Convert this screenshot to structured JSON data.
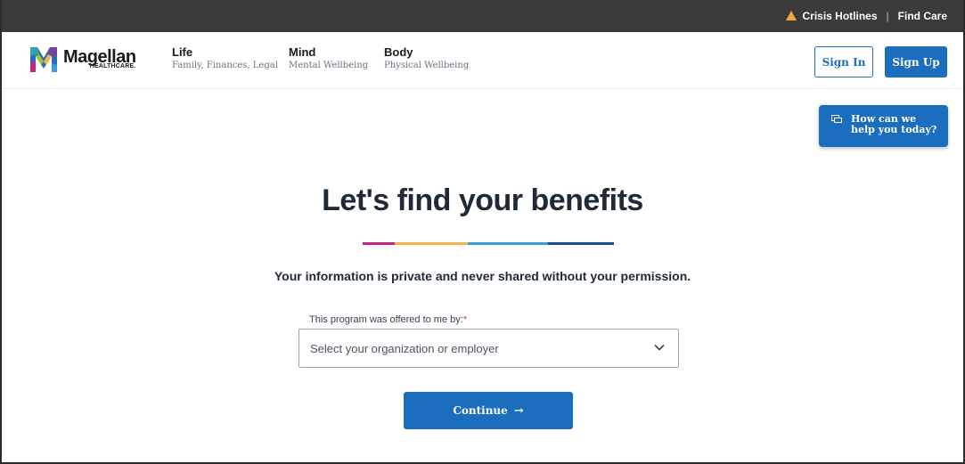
{
  "topbar": {
    "crisis_link": "Crisis Hotlines",
    "separator": "|",
    "find_care_link": "Find Care",
    "warning_color": "#f2a93b"
  },
  "header": {
    "logo": {
      "name": "Magellan",
      "sub": "HEALTHCARE."
    },
    "nav": [
      {
        "title": "Life",
        "sub": "Family, Finances, Legal"
      },
      {
        "title": "Mind",
        "sub": "Mental Wellbeing"
      },
      {
        "title": "Body",
        "sub": "Physical Wellbeing"
      }
    ],
    "sign_in": "Sign In",
    "sign_up": "Sign Up"
  },
  "help_widget": {
    "line1": "How can we",
    "line2": "help you today?"
  },
  "main": {
    "title": "Let's find your benefits",
    "subtitle": "Your information is private and never shared without your permission.",
    "field_label": "This program was offered to me by:",
    "required_mark": "*",
    "select_placeholder": "Select your organization or employer",
    "continue_label": "Continue",
    "continue_arrow": "→"
  },
  "colors": {
    "primary": "#1a6ebd",
    "rule": [
      "#c8247e",
      "#f0b449",
      "#3a9bd8",
      "#1a4d8c"
    ]
  }
}
